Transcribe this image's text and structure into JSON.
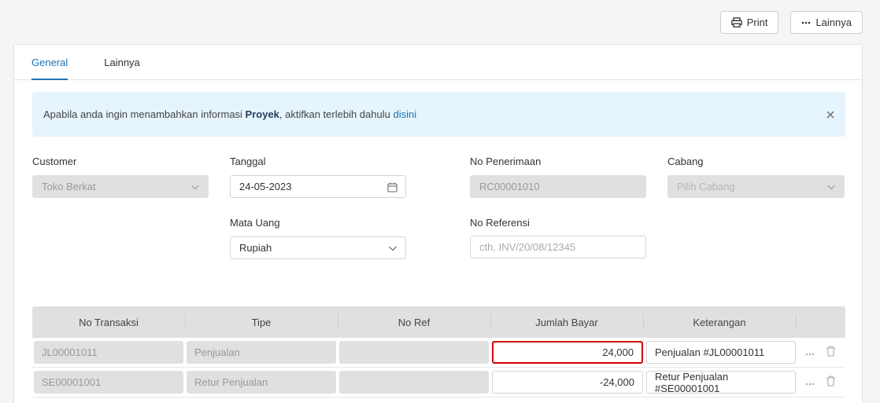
{
  "toolbar": {
    "print_label": "Print",
    "more_label": "Lainnya"
  },
  "tabs": [
    {
      "label": "General",
      "active": true
    },
    {
      "label": "Lainnya",
      "active": false
    }
  ],
  "alert": {
    "text_before": "Apabila anda ingin menambahkan informasi ",
    "bold": "Proyek",
    "text_after": ", aktifkan terlebih dahulu ",
    "link": "disini"
  },
  "form": {
    "customer": {
      "label": "Customer",
      "value": "Toko Berkat"
    },
    "tanggal": {
      "label": "Tanggal",
      "value": "24-05-2023"
    },
    "no_penerimaan": {
      "label": "No Penerimaan",
      "value": "RC00001010"
    },
    "cabang": {
      "label": "Cabang",
      "placeholder": "Pilih Cabang"
    },
    "mata_uang": {
      "label": "Mata Uang",
      "value": "Rupiah"
    },
    "no_referensi": {
      "label": "No Referensi",
      "placeholder": "cth. INV/20/08/12345"
    }
  },
  "table": {
    "headers": [
      "No Transaksi",
      "Tipe",
      "No Ref",
      "Jumlah Bayar",
      "Keterangan"
    ],
    "rows": [
      {
        "no_transaksi": "JL00001011",
        "tipe": "Penjualan",
        "no_ref": "",
        "jumlah_bayar": "24,000",
        "keterangan": "Penjualan #JL00001011"
      },
      {
        "no_transaksi": "SE00001001",
        "tipe": "Retur Penjualan",
        "no_ref": "",
        "jumlah_bayar": "-24,000",
        "keterangan": "Retur Penjualan #SE00001001"
      }
    ]
  },
  "icons": {
    "print": "printer-icon",
    "more": "ellipsis-icon",
    "close": "close-icon",
    "calendar": "calendar-icon",
    "chevron": "chevron-down-icon",
    "row_more": "ellipsis-icon",
    "delete": "trash-icon"
  },
  "colors": {
    "accent": "#1a73b8",
    "alert_bg": "#e6f5fd",
    "disabled_bg": "#e0e0e0",
    "focus_border": "#d40000"
  }
}
